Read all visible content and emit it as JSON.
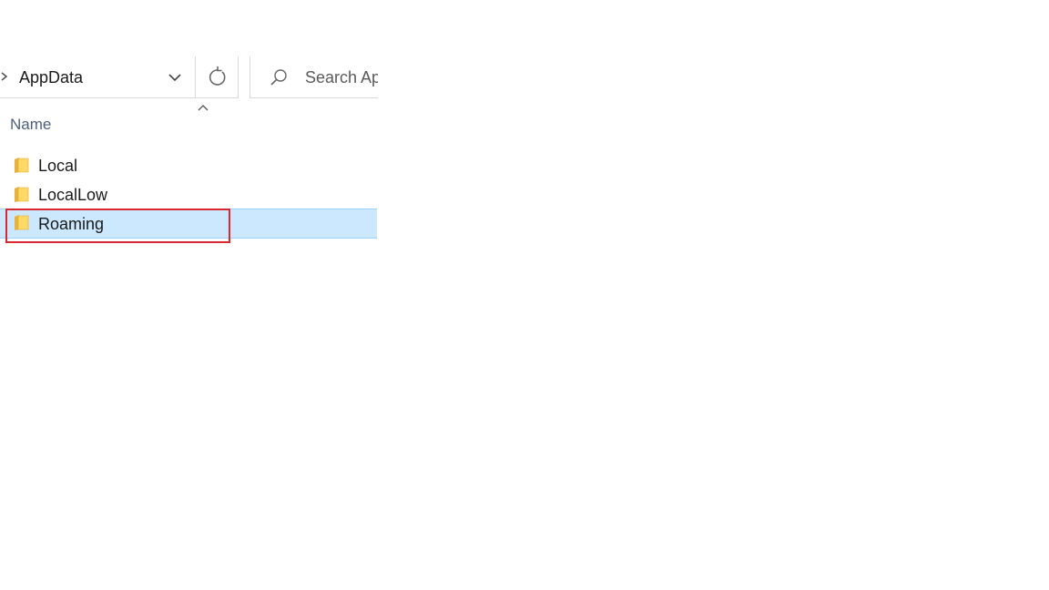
{
  "address_bar": {
    "current_folder": "AppData"
  },
  "search": {
    "placeholder": "Search AppData"
  },
  "file_list": {
    "column_header": "Name",
    "items": [
      {
        "name": "Local",
        "type": "folder",
        "selected": false
      },
      {
        "name": "LocalLow",
        "type": "folder",
        "selected": false
      },
      {
        "name": "Roaming",
        "type": "folder",
        "selected": true
      }
    ]
  },
  "colors": {
    "selection_bg": "#cce8ff",
    "selection_border": "#99d1ff",
    "highlight_annotation": "#d9282f",
    "folder_yellow": "#ffd966"
  },
  "icons": {
    "breadcrumb": "chevron-right-icon",
    "dropdown": "chevron-down-icon",
    "refresh": "refresh-icon",
    "search": "search-icon",
    "sort": "sort-ascending-icon",
    "folder": "folder-icon"
  }
}
